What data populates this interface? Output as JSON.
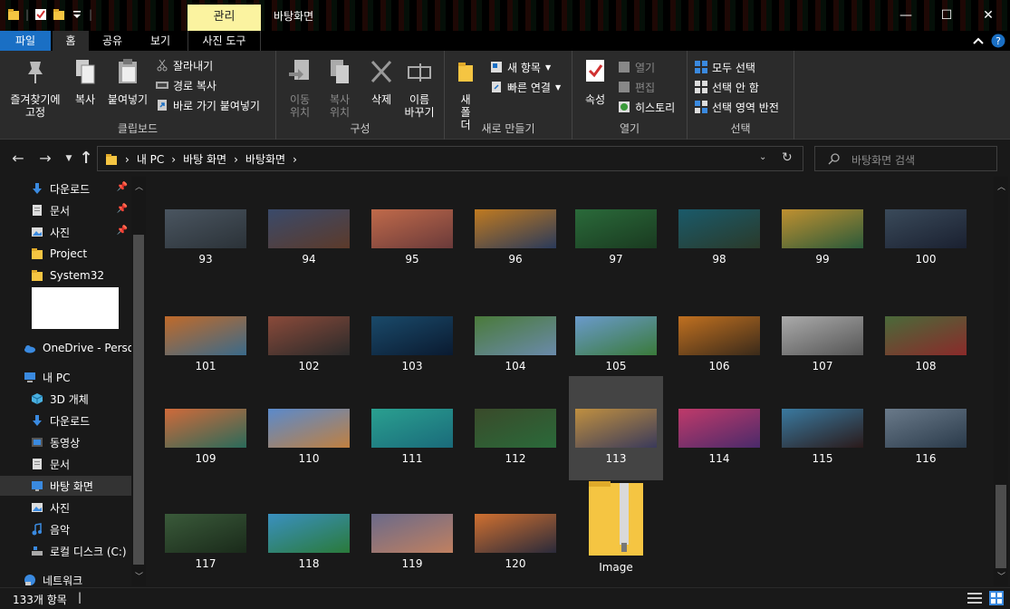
{
  "window": {
    "title": "바탕화면",
    "context_tab": "관리",
    "controls": {
      "minimize": "—",
      "maximize": "☐",
      "close": "✕"
    }
  },
  "ribbon_tabs": [
    "파일",
    "홈",
    "공유",
    "보기",
    "사진 도구"
  ],
  "ribbon": {
    "clipboard": {
      "label": "클립보드",
      "pin": "즐겨찾기에 고정",
      "copy": "복사",
      "paste": "붙여넣기",
      "cut": "잘라내기",
      "copy_path": "경로 복사",
      "paste_shortcut": "바로 가기 붙여넣기"
    },
    "organize": {
      "label": "구성",
      "move": "이동 위치",
      "copy_to": "복사 위치",
      "delete": "삭제",
      "rename": "이름 바꾸기"
    },
    "new": {
      "label": "새로 만들기",
      "new_folder": "새 폴더",
      "new_item": "새 항목",
      "easy_access": "빠른 연결"
    },
    "open": {
      "label": "열기",
      "properties": "속성",
      "open": "열기",
      "edit": "편집",
      "history": "히스토리"
    },
    "select": {
      "label": "선택",
      "select_all": "모두 선택",
      "select_none": "선택 안 함",
      "invert": "선택 영역 반전"
    }
  },
  "address": {
    "crumbs": [
      "내 PC",
      "바탕 화면",
      "바탕화면"
    ],
    "search_placeholder": "바탕화면 검색"
  },
  "nav_pane": {
    "items": [
      {
        "label": "다운로드",
        "icon": "download-icon",
        "pinned": true
      },
      {
        "label": "문서",
        "icon": "document-icon",
        "pinned": true
      },
      {
        "label": "사진",
        "icon": "pictures-icon",
        "pinned": true
      },
      {
        "label": "Project",
        "icon": "folder-icon",
        "pinned": false
      },
      {
        "label": "System32",
        "icon": "folder-icon",
        "pinned": false
      },
      {
        "label": "OneDrive - Persor",
        "icon": "onedrive-icon",
        "pinned": false
      },
      {
        "label": "내 PC",
        "icon": "pc-icon",
        "pinned": false
      },
      {
        "label": "3D 개체",
        "icon": "3d-objects-icon",
        "pinned": false
      },
      {
        "label": "다운로드",
        "icon": "download-icon",
        "pinned": false
      },
      {
        "label": "동영상",
        "icon": "video-icon",
        "pinned": false
      },
      {
        "label": "문서",
        "icon": "document-icon",
        "pinned": false
      },
      {
        "label": "바탕 화면",
        "icon": "desktop-icon",
        "pinned": false,
        "selected": true
      },
      {
        "label": "사진",
        "icon": "pictures-icon",
        "pinned": false
      },
      {
        "label": "음악",
        "icon": "music-icon",
        "pinned": false
      },
      {
        "label": "로컬 디스크 (C:)",
        "icon": "drive-icon",
        "pinned": false
      },
      {
        "label": "네트워크",
        "icon": "network-icon",
        "pinned": false
      }
    ]
  },
  "files": [
    {
      "name": "93",
      "c1": "#4a5560",
      "c2": "#2b3238"
    },
    {
      "name": "94",
      "c1": "#3a4a6a",
      "c2": "#5c3a2a"
    },
    {
      "name": "95",
      "c1": "#c06a4a",
      "c2": "#6a3a3a"
    },
    {
      "name": "96",
      "c1": "#c07a20",
      "c2": "#2a3a5a"
    },
    {
      "name": "97",
      "c1": "#2a6a3a",
      "c2": "#1a3a20"
    },
    {
      "name": "98",
      "c1": "#1a5a6a",
      "c2": "#2a3a2a"
    },
    {
      "name": "99",
      "c1": "#c09030",
      "c2": "#2a5a3a"
    },
    {
      "name": "100",
      "c1": "#3a4a5a",
      "c2": "#1a2030"
    },
    {
      "name": "101",
      "c1": "#c06a2a",
      "c2": "#3a6a8a"
    },
    {
      "name": "102",
      "c1": "#8a4a3a",
      "c2": "#2a2a2a"
    },
    {
      "name": "103",
      "c1": "#1a4a6a",
      "c2": "#0a1a30"
    },
    {
      "name": "104",
      "c1": "#4a7a3a",
      "c2": "#6a8aaa"
    },
    {
      "name": "105",
      "c1": "#6a9acc",
      "c2": "#3a7a3a"
    },
    {
      "name": "106",
      "c1": "#c07020",
      "c2": "#3a2a1a"
    },
    {
      "name": "107",
      "c1": "#aaaaaa",
      "c2": "#555555"
    },
    {
      "name": "108",
      "c1": "#4a6a3a",
      "c2": "#8a2a2a"
    },
    {
      "name": "109",
      "c1": "#d06a3a",
      "c2": "#2a6a5a"
    },
    {
      "name": "110",
      "c1": "#5a8acc",
      "c2": "#c08040"
    },
    {
      "name": "111",
      "c1": "#2aa090",
      "c2": "#1a6a7a"
    },
    {
      "name": "112",
      "c1": "#3a4a2a",
      "c2": "#2a6a3a"
    },
    {
      "name": "113",
      "c1": "#c09040",
      "c2": "#3a3a5a",
      "selected": true
    },
    {
      "name": "114",
      "c1": "#c03a6a",
      "c2": "#4a2a6a"
    },
    {
      "name": "115",
      "c1": "#3a7aa0",
      "c2": "#2a1a1a"
    },
    {
      "name": "116",
      "c1": "#6a7a8a",
      "c2": "#2a3a4a"
    },
    {
      "name": "117",
      "c1": "#3a5a3a",
      "c2": "#1a2a1a"
    },
    {
      "name": "118",
      "c1": "#3a90c0",
      "c2": "#2a7a3a"
    },
    {
      "name": "119",
      "c1": "#6a6a8a",
      "c2": "#c08060"
    },
    {
      "name": "120",
      "c1": "#d07030",
      "c2": "#2a2a3a"
    },
    {
      "name": "Image",
      "zip": true
    }
  ],
  "status": {
    "count": "133개 항목"
  }
}
